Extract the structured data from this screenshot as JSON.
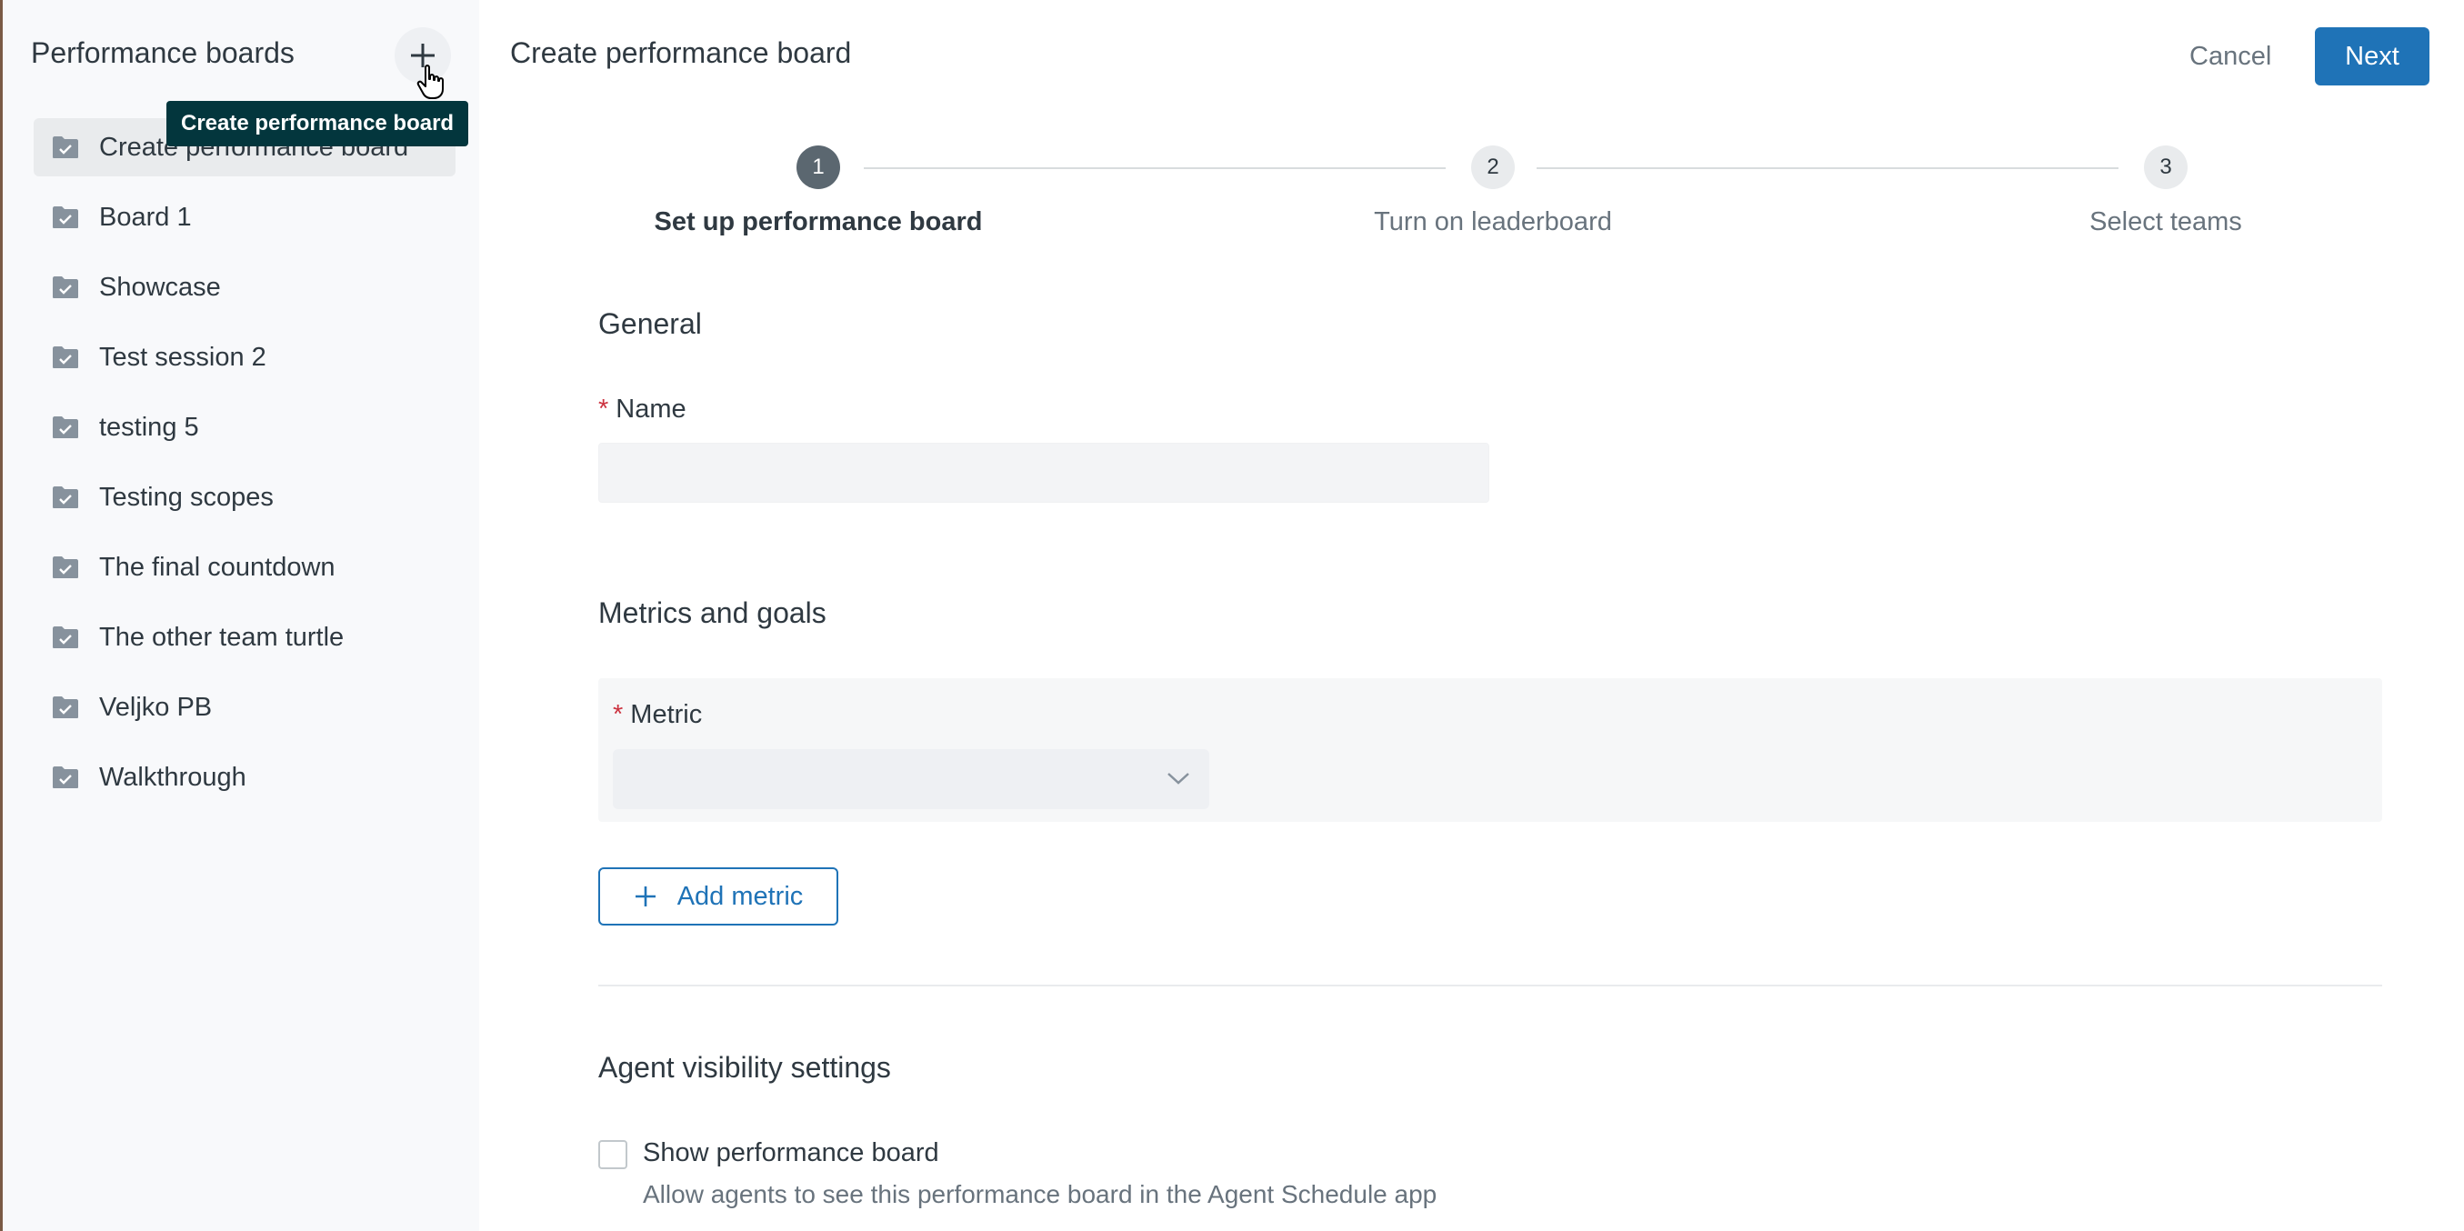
{
  "sidebar": {
    "title": "Performance boards",
    "add_tooltip": "Create performance board",
    "items": [
      {
        "label": "Create performance board",
        "selected": true
      },
      {
        "label": "Board 1",
        "selected": false
      },
      {
        "label": "Showcase",
        "selected": false
      },
      {
        "label": "Test session 2",
        "selected": false
      },
      {
        "label": "testing 5",
        "selected": false
      },
      {
        "label": "Testing scopes",
        "selected": false
      },
      {
        "label": "The final countdown",
        "selected": false
      },
      {
        "label": "The other team turtle",
        "selected": false
      },
      {
        "label": "Veljko PB",
        "selected": false
      },
      {
        "label": "Walkthrough",
        "selected": false
      }
    ]
  },
  "header": {
    "title": "Create performance board",
    "cancel_label": "Cancel",
    "next_label": "Next"
  },
  "stepper": {
    "steps": [
      {
        "number": "1",
        "label": "Set up performance board",
        "active": true
      },
      {
        "number": "2",
        "label": "Turn on leaderboard",
        "active": false
      },
      {
        "number": "3",
        "label": "Select teams",
        "active": false
      }
    ]
  },
  "form": {
    "general": {
      "title": "General",
      "name_label": "Name",
      "name_value": "",
      "required_mark": "*"
    },
    "metrics": {
      "title": "Metrics and goals",
      "metric_label": "Metric",
      "metric_value": "",
      "add_metric_label": "Add metric"
    },
    "visibility": {
      "title": "Agent visibility settings",
      "checkbox_label": "Show performance board",
      "checkbox_checked": false,
      "checkbox_hint": "Allow agents to see this performance board in the Agent Schedule app"
    }
  },
  "colors": {
    "primary": "#1f73b7",
    "sidebar_bg": "#f8f9fb",
    "tooltip_bg": "#03363d",
    "required": "#cc3340",
    "step_active": "#5b6770"
  },
  "icons": {
    "add": "plus-icon",
    "board": "folder-check-icon",
    "dropdown": "chevron-down-icon",
    "cursor": "hand-pointer-icon"
  }
}
